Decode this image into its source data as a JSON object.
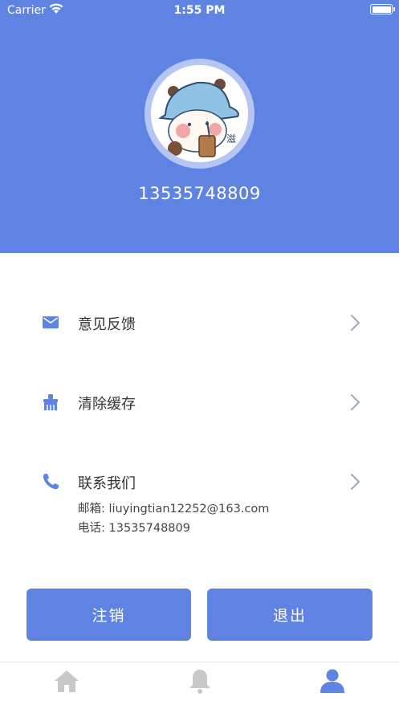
{
  "status_bar": {
    "carrier": "Carrier",
    "time": "1:55 PM"
  },
  "profile": {
    "phone": "13535748809",
    "avatar_text": "滋"
  },
  "menu": {
    "feedback": {
      "label": "意见反馈",
      "icon": "mail-icon"
    },
    "clear_cache": {
      "label": "清除缓存",
      "icon": "broom-icon"
    },
    "contact": {
      "label": "联系我们",
      "icon": "phone-icon",
      "email_line": "邮箱: liuyingtian12252@163.com",
      "phone_line": "电话: 13535748809"
    }
  },
  "buttons": {
    "logout_account": "注销",
    "exit": "退出"
  },
  "tabbar": {
    "items": [
      {
        "name": "home",
        "icon": "home-icon",
        "active": false
      },
      {
        "name": "notifications",
        "icon": "bell-icon",
        "active": false
      },
      {
        "name": "profile",
        "icon": "person-icon",
        "active": true
      }
    ]
  },
  "colors": {
    "accent": "#5f83e3",
    "inactive_icon": "#c8c8c8",
    "chevron": "#a0a8b8"
  }
}
